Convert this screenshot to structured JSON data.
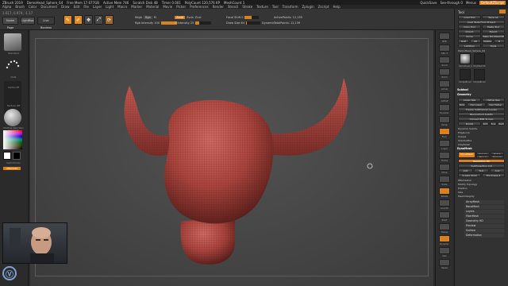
{
  "titlebar": {
    "app": "ZBrush 2019",
    "file": "DemoHead_Sphere_64",
    "free_mem": "Free Mem 17.677GB",
    "active_mem": "Active Mem 746",
    "scratch_disk": "Scratch Disk 48",
    "timer": "Timer 0.001",
    "poly_count": "PolyCount 120,576 KP",
    "mesh_count": "MeshCount 1",
    "quicksave": "QuickSave",
    "see_through": "See-through 0",
    "menus": "Menus",
    "default_zscript": "DefaultZScript"
  },
  "menubar": [
    "Alpha",
    "Brush",
    "Color",
    "Document",
    "Draw",
    "Edit",
    "File",
    "Layer",
    "Light",
    "Macro",
    "Marker",
    "Material",
    "Movie",
    "Picker",
    "Preferences",
    "Render",
    "Stencil",
    "Stroke",
    "Texture",
    "Tool",
    "Transform",
    "Zplugin",
    "Zscript",
    "Help"
  ],
  "shelf": {
    "info": "1.617, 0.974, -1.17",
    "buttons": [
      "Home Page",
      "LightBox",
      "Live Boolean"
    ],
    "modes": [
      "Edit",
      "Draw",
      "Move",
      "Scale",
      "Rotate"
    ],
    "mrgb": "Mrgb",
    "rgb": "Rgb",
    "m": "M",
    "rgb_intensity": "Rgb Intensity 100",
    "zadd": "Zadd",
    "zsub": "Zsub",
    "zcut": "Zcut",
    "z_intensity": "Z Intensity 25",
    "focal_shift": "Focal Shift 0",
    "draw_size": "Draw Size 64",
    "dynamic": "Dynamic",
    "active_points": "ActivePoints: 12,139",
    "total_points": "TotalPoints: 12,139"
  },
  "leftpanel": {
    "labels": [
      "Standard",
      "Dots",
      "Alpha Off",
      "Texture Off",
      "MatCap Red Wax"
    ],
    "gradient": "Gradient",
    "switch_color": "SwitchColor",
    "alternate": "Alternate"
  },
  "rightshelf": [
    "BPR",
    "SPix 3",
    "Scroll",
    "Zoom",
    "Actual",
    "AAHalf",
    "Dynamic",
    "Persp",
    "Floor",
    "L.Sym",
    "Frame",
    "Move",
    "Scale",
    "Rotate",
    "Line Fill",
    "PolyF",
    "Transp",
    "Dynamic",
    "Solo",
    "Xpose"
  ],
  "tray": {
    "title": "Tool",
    "buttons": [
      [
        "Load Tool",
        "Save As"
      ],
      [
        "Load Tools From Project"
      ],
      [
        "Copy Tool",
        "Paste Tool"
      ],
      [
        "Import",
        "Export"
      ],
      [
        "Clone",
        "Make PolyMesh3D"
      ],
      [
        "GoZ",
        "All",
        "Visible",
        "R"
      ],
      [
        "Lightbox",
        "Tools"
      ]
    ],
    "tool_name": "DemoHead_Sphere_64",
    "thumbs": [
      "DemoHead_S",
      "PolyMesh3D",
      "SimpleBrush",
      "SimpleBrush"
    ],
    "subtool": "Subtool",
    "geometry": "Geometry",
    "geo_items": [
      "Lower Res",
      "Higher Res",
      "SDiv",
      "Del Lower",
      "Del Higher",
      "Freeze SubDivision Levels",
      "Reconstruct Subdiv",
      "Convert BPR To Geo"
    ],
    "divide": "Divide",
    "geo_more": [
      "Smt",
      "Suv",
      "ReUV"
    ],
    "sections": [
      "Dynamic Subdiv",
      "EdgeLoop",
      "Crease",
      "ShadowBox",
      "ClayPolish"
    ],
    "dynamesh_header": "DynaMesh",
    "dynamesh_btn": "DynaMesh",
    "dynamesh_opts": [
      "Groups",
      "Polish",
      "Blur 2",
      "Project"
    ],
    "resolution": "Resolution 64",
    "subproject": "SubProjection 0.6",
    "add_sub_and": [
      "Add",
      "Sub",
      "And"
    ],
    "create_shell": "Create Shell",
    "thickness": "Thickness 4",
    "lower": [
      "ZRemesher",
      "Modify Topology",
      "Position",
      "Size",
      "MeshIntegrity"
    ],
    "bottom": [
      "ArrayMesh",
      "NanoMesh",
      "Layers",
      "FiberMesh",
      "Geometry HD",
      "Preview",
      "Surface",
      "Deformation"
    ]
  },
  "colors": {
    "accent": "#d9811b",
    "mesh": "#b8514a",
    "mesh_dark": "#6b2622"
  }
}
